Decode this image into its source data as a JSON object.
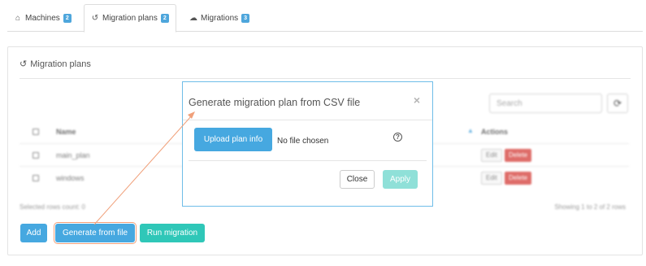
{
  "tabs": [
    {
      "label": "Machines",
      "badge": "2",
      "icon": "home-icon"
    },
    {
      "label": "Migration plans",
      "badge": "2",
      "icon": "history-icon"
    },
    {
      "label": "Migrations",
      "badge": "3",
      "icon": "cloud-icon"
    }
  ],
  "panel": {
    "title": "Migration plans",
    "search_placeholder": "Search",
    "table": {
      "headers": {
        "name": "Name",
        "actions": "Actions"
      },
      "rows": [
        {
          "name": "main_plan",
          "edit": "Edit",
          "delete": "Delete"
        },
        {
          "name": "windows",
          "edit": "Edit",
          "delete": "Delete"
        }
      ]
    },
    "selected_count": "Selected rows count: 0",
    "pagination": "Showing 1 to 2 of 2 rows"
  },
  "buttons": {
    "add": "Add",
    "generate": "Generate from file",
    "run": "Run migration"
  },
  "modal": {
    "title": "Generate migration plan from CSV file",
    "close_icon": "×",
    "upload_label": "Upload plan info",
    "file_status": "No file chosen",
    "help": "?",
    "close_label": "Close",
    "apply_label": "Apply"
  },
  "colors": {
    "primary": "#46a8e0",
    "teal": "#2fc7b8",
    "danger": "#d9534f",
    "annotation": "#f0a07a"
  }
}
